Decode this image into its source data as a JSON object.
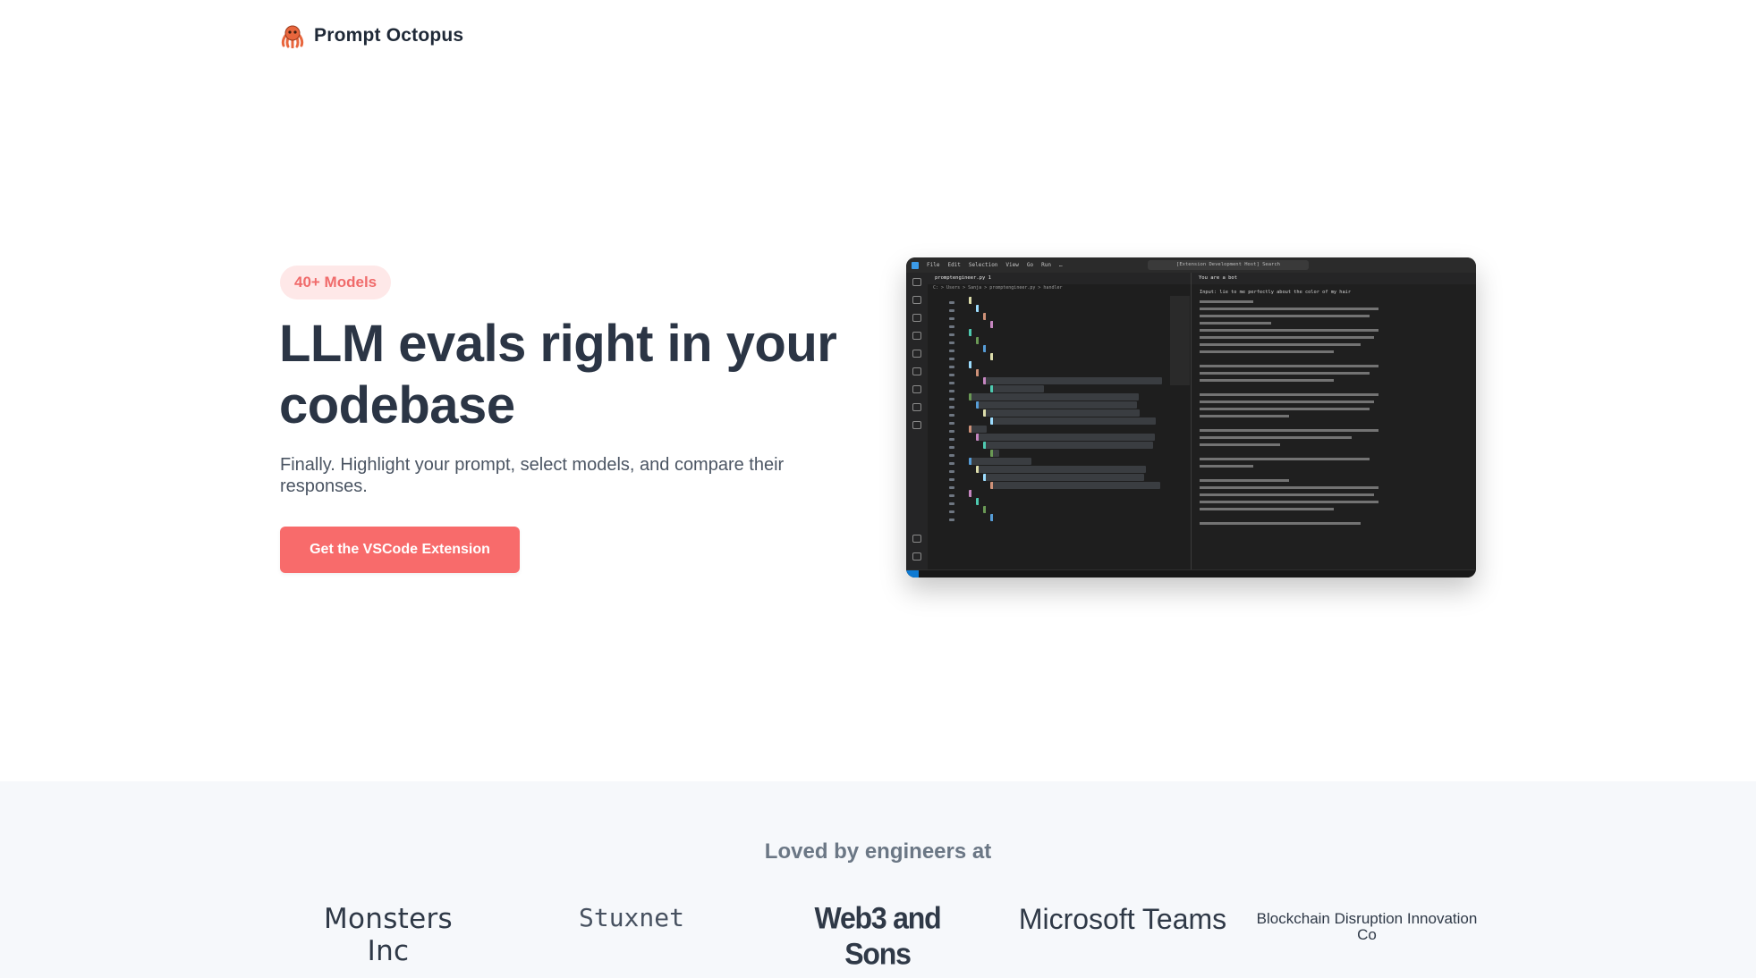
{
  "brand": {
    "name": "Prompt Octopus",
    "icon": "octopus-icon",
    "icon_color": "#e8663d"
  },
  "hero": {
    "badge": "40+ Models",
    "title": "LLM evals right in your codebase",
    "subtitle": "Finally. Highlight your prompt, select models, and compare their responses.",
    "cta_label": "Get the VSCode Extension"
  },
  "screenshot": {
    "window_menu": [
      "File",
      "Edit",
      "Selection",
      "View",
      "Go",
      "Run",
      "…"
    ],
    "search": "[Extension Development Host] Search",
    "editor_tab": "promptengineer.py 1",
    "breadcrumb": "C: > Users > Sanja > promptengineer.py > handler",
    "panel_tab": "You are a bot",
    "panel_heading": "Input: lie to me perfectly about the color of my hair"
  },
  "logos": {
    "title": "Loved by engineers at",
    "items": [
      "Monsters Inc",
      "Stuxnet",
      "Web3 and Sons",
      "Microsoft Teams",
      "Blockchain Disruption Innovation Co"
    ]
  },
  "colors": {
    "accent": "#f86b6b",
    "badge_bg": "#fee8e8",
    "badge_text": "#f06b6b",
    "heading": "#2b3545",
    "band_bg": "#f6f8fb"
  }
}
